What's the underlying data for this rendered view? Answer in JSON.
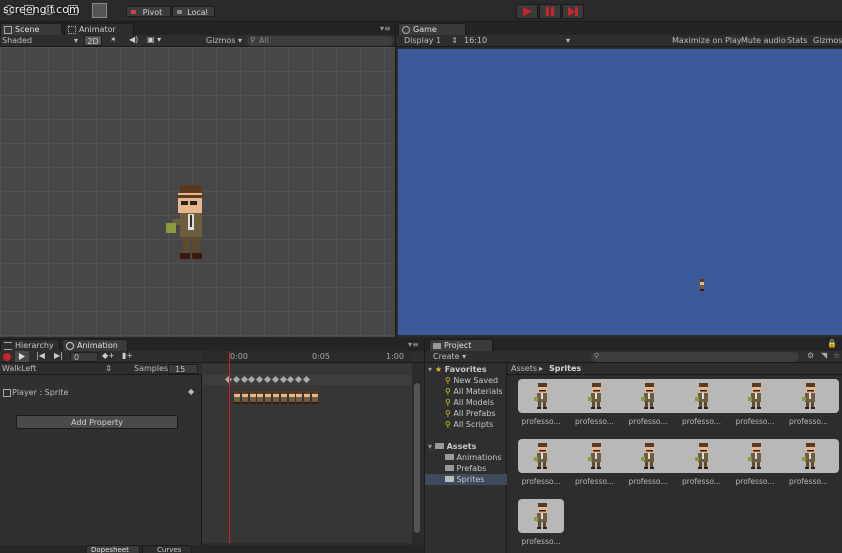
{
  "watermark": "screengif.com",
  "toolbar": {
    "pivot_label": "Pivot",
    "local_label": "Local"
  },
  "scene": {
    "tab_scene": "Scene",
    "tab_animator": "Animator",
    "shading_mode": "Shaded",
    "mode_2d": "2D",
    "gizmos_label": "Gizmos",
    "search_placeholder": "All"
  },
  "game": {
    "tab_label": "Game",
    "display_label": "Display 1",
    "aspect_label": "16:10",
    "maximize_label": "Maximize on Play",
    "mute_label": "Mute audio",
    "stats_label": "Stats",
    "gizmos_label": "Gizmos",
    "bg_color": "#3a5a9a"
  },
  "hierarchy": {
    "tab_label": "Hierarchy"
  },
  "animation": {
    "tab_label": "Animation",
    "frame_value": "0",
    "clip_name": "WalkLeft",
    "samples_label": "Samples",
    "samples_value": "15",
    "property_label": "Player : Sprite",
    "add_property_label": "Add Property",
    "ruler_labels": [
      "0:00",
      "0:05",
      "1:00"
    ],
    "bottom_tab_dopesheet": "Dopesheet",
    "bottom_tab_curves": "Curves",
    "keyframe_count": 11
  },
  "project": {
    "tab_label": "Project",
    "create_label": "Create",
    "favorites_label": "Favorites",
    "favorites": [
      "New Saved",
      "All Materials",
      "All Models",
      "All Prefabs",
      "All Scripts"
    ],
    "assets_label": "Assets",
    "folders": [
      "Animations",
      "Prefabs",
      "Sprites"
    ],
    "breadcrumb_root": "Assets",
    "breadcrumb_current": "Sprites",
    "asset_items": [
      "professo...",
      "professo...",
      "professo...",
      "professo...",
      "professo...",
      "professo...",
      "professo...",
      "professo...",
      "professo...",
      "professo...",
      "professo...",
      "professo...",
      "professo..."
    ]
  },
  "colors": {
    "play_red": "#c8262a",
    "favorite_star": "#e8b431",
    "search_icon_yellow": "#e7c423",
    "timeline_cursor": "#d42020"
  }
}
